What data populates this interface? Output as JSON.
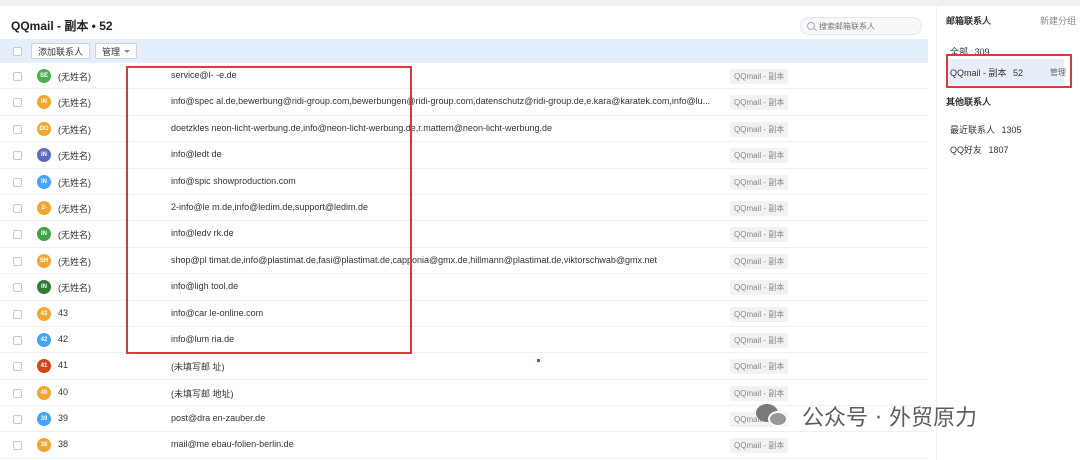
{
  "main": {
    "title": "QQmail - 副本 • 52",
    "search_placeholder": "搜索邮箱联系人"
  },
  "toolbar": {
    "add_label": "添加联系人",
    "manage_label": "管理"
  },
  "contacts": [
    {
      "initials": "SE",
      "name": "(无姓名)",
      "email": "service@l-  -e.de",
      "group": "QQmail - 副本",
      "color": "#4caf50"
    },
    {
      "initials": "IN",
      "name": "(无姓名)",
      "email": "info@spec   al.de,bewerbung@ridi-group.com,bewerbungen@ridi-group.com,datenschutz@ridi-group.de,e.kara@karatek.com,info@lu...",
      "group": "QQmail - 副本",
      "color": "#f0a830"
    },
    {
      "initials": "DO",
      "name": "(无姓名)",
      "email": "doetzkles   neon-licht-werbung.de,info@neon-licht-werbung.de,r.mattern@neon-licht-werbung.de",
      "group": "QQmail - 副本",
      "color": "#f0a830"
    },
    {
      "initials": "IN",
      "name": "(无姓名)",
      "email": "info@ledt   de",
      "group": "QQmail - 副本",
      "color": "#5c6bc0"
    },
    {
      "initials": "IN",
      "name": "(无姓名)",
      "email": "info@spic   showproduction.com",
      "group": "QQmail - 副本",
      "color": "#42a5f5"
    },
    {
      "initials": "2-",
      "name": "(无姓名)",
      "email": "2-info@le   m.de,info@ledim.de,support@ledim.de",
      "group": "QQmail - 副本",
      "color": "#f0a830"
    },
    {
      "initials": "IN",
      "name": "(无姓名)",
      "email": "info@ledv   rk.de",
      "group": "QQmail - 副本",
      "color": "#43a047"
    },
    {
      "initials": "SH",
      "name": "(无姓名)",
      "email": "shop@pl   timat.de,info@plastimat.de,fasi@plastimat.de,capponia@gmx.de,hillmann@plastimat.de,viktorschwab@gmx.net",
      "group": "QQmail - 副本",
      "color": "#f0a830"
    },
    {
      "initials": "IN",
      "name": "(无姓名)",
      "email": "info@ligh   tool.de",
      "group": "QQmail - 副本",
      "color": "#2e7d32"
    },
    {
      "initials": "43",
      "name": "43",
      "email": "info@car   le-online.com",
      "group": "QQmail - 副本",
      "color": "#f0a830"
    },
    {
      "initials": "42",
      "name": "42",
      "email": "info@lum   ria.de",
      "group": "QQmail - 副本",
      "color": "#42a5f5"
    },
    {
      "initials": "41",
      "name": "41",
      "email": "(未填写邮   址)",
      "group": "QQmail - 副本",
      "color": "#d84315"
    },
    {
      "initials": "40",
      "name": "40",
      "email": "(未填写邮   地址)",
      "group": "QQmail - 副本",
      "color": "#f0a830"
    },
    {
      "initials": "39",
      "name": "39",
      "email": "post@dra   en-zauber.de",
      "group": "QQmail - 副本",
      "color": "#42a5f5"
    },
    {
      "initials": "38",
      "name": "38",
      "email": "mail@me   ebau-folien-berlin.de",
      "group": "QQmail - 副本",
      "color": "#f0a830"
    }
  ],
  "sidebar": {
    "mail_contacts_title": "邮箱联系人",
    "new_group": "新建分组",
    "all": "全部",
    "all_count": "309",
    "qqmail_copy": "QQmail - 副本",
    "qqmail_copy_count": "52",
    "manage": "管理",
    "other_contacts_title": "其他联系人",
    "recent": "最近联系人",
    "recent_count": "1305",
    "qq_friends": "QQ好友",
    "qq_friends_count": "1807"
  },
  "watermark": {
    "text": "公众号 · 外贸原力"
  },
  "accent_colors": {
    "annotation_red": "#d93a3a",
    "toolbar_blue": "#e5eefb"
  }
}
